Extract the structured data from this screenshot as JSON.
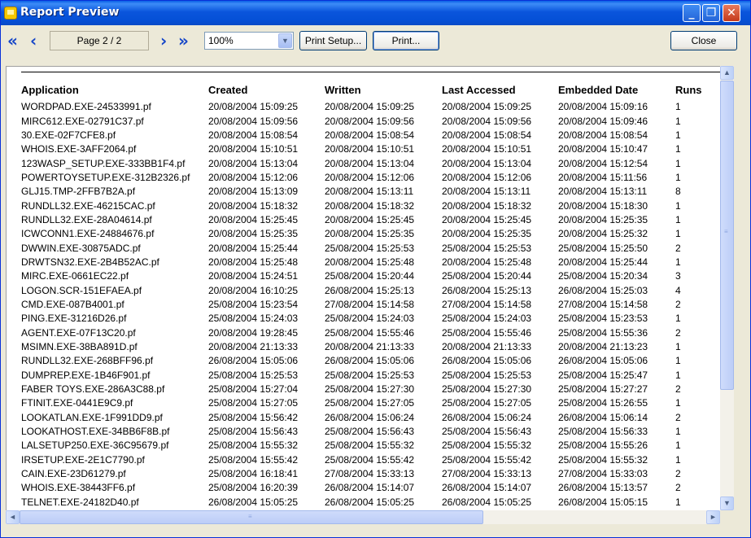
{
  "window": {
    "title": "Report Preview",
    "minimize_glyph": "_",
    "maximize_glyph": "❐",
    "close_glyph": "✕"
  },
  "toolbar": {
    "first_glyph": "«",
    "prev_glyph": "‹",
    "next_glyph": "›",
    "last_glyph": "»",
    "page_label": "Page 2 / 2",
    "zoom_value": "100%",
    "print_setup_label": "Print Setup...",
    "print_label": "Print...",
    "close_label": "Close"
  },
  "icons": {
    "first": "first-page-icon",
    "prev": "previous-page-icon",
    "next": "next-page-icon",
    "last": "last-page-icon"
  },
  "report": {
    "headers": [
      "Application",
      "Created",
      "Written",
      "Last Accessed",
      "Embedded Date",
      "Runs"
    ],
    "rows": [
      [
        "WORDPAD.EXE-24533991.pf",
        "20/08/2004 15:09:25",
        "20/08/2004 15:09:25",
        "20/08/2004 15:09:25",
        "20/08/2004 15:09:16",
        "1"
      ],
      [
        "MIRC612.EXE-02791C37.pf",
        "20/08/2004 15:09:56",
        "20/08/2004 15:09:56",
        "20/08/2004 15:09:56",
        "20/08/2004 15:09:46",
        "1"
      ],
      [
        "30.EXE-02F7CFE8.pf",
        "20/08/2004 15:08:54",
        "20/08/2004 15:08:54",
        "20/08/2004 15:08:54",
        "20/08/2004 15:08:54",
        "1"
      ],
      [
        "WHOIS.EXE-3AFF2064.pf",
        "20/08/2004 15:10:51",
        "20/08/2004 15:10:51",
        "20/08/2004 15:10:51",
        "20/08/2004 15:10:47",
        "1"
      ],
      [
        "123WASP_SETUP.EXE-333BB1F4.pf",
        "20/08/2004 15:13:04",
        "20/08/2004 15:13:04",
        "20/08/2004 15:13:04",
        "20/08/2004 15:12:54",
        "1"
      ],
      [
        "POWERTOYSETUP.EXE-312B2326.pf",
        "20/08/2004 15:12:06",
        "20/08/2004 15:12:06",
        "20/08/2004 15:12:06",
        "20/08/2004 15:11:56",
        "1"
      ],
      [
        "GLJ15.TMP-2FFB7B2A.pf",
        "20/08/2004 15:13:09",
        "20/08/2004 15:13:11",
        "20/08/2004 15:13:11",
        "20/08/2004 15:13:11",
        "8"
      ],
      [
        "RUNDLL32.EXE-46215CAC.pf",
        "20/08/2004 15:18:32",
        "20/08/2004 15:18:32",
        "20/08/2004 15:18:32",
        "20/08/2004 15:18:30",
        "1"
      ],
      [
        "RUNDLL32.EXE-28A04614.pf",
        "20/08/2004 15:25:45",
        "20/08/2004 15:25:45",
        "20/08/2004 15:25:45",
        "20/08/2004 15:25:35",
        "1"
      ],
      [
        "ICWCONN1.EXE-24884676.pf",
        "20/08/2004 15:25:35",
        "20/08/2004 15:25:35",
        "20/08/2004 15:25:35",
        "20/08/2004 15:25:32",
        "1"
      ],
      [
        "DWWIN.EXE-30875ADC.pf",
        "20/08/2004 15:25:44",
        "25/08/2004 15:25:53",
        "25/08/2004 15:25:53",
        "25/08/2004 15:25:50",
        "2"
      ],
      [
        "DRWTSN32.EXE-2B4B52AC.pf",
        "20/08/2004 15:25:48",
        "20/08/2004 15:25:48",
        "20/08/2004 15:25:48",
        "20/08/2004 15:25:44",
        "1"
      ],
      [
        "MIRC.EXE-0661EC22.pf",
        "20/08/2004 15:24:51",
        "25/08/2004 15:20:44",
        "25/08/2004 15:20:44",
        "25/08/2004 15:20:34",
        "3"
      ],
      [
        "LOGON.SCR-151EFAEA.pf",
        "20/08/2004 16:10:25",
        "26/08/2004 15:25:13",
        "26/08/2004 15:25:13",
        "26/08/2004 15:25:03",
        "4"
      ],
      [
        "CMD.EXE-087B4001.pf",
        "25/08/2004 15:23:54",
        "27/08/2004 15:14:58",
        "27/08/2004 15:14:58",
        "27/08/2004 15:14:58",
        "2"
      ],
      [
        "PING.EXE-31216D26.pf",
        "25/08/2004 15:24:03",
        "25/08/2004 15:24:03",
        "25/08/2004 15:24:03",
        "25/08/2004 15:23:53",
        "1"
      ],
      [
        "AGENT.EXE-07F13C20.pf",
        "20/08/2004 19:28:45",
        "25/08/2004 15:55:46",
        "25/08/2004 15:55:46",
        "25/08/2004 15:55:36",
        "2"
      ],
      [
        "MSIMN.EXE-38BA891D.pf",
        "20/08/2004 21:13:33",
        "20/08/2004 21:13:33",
        "20/08/2004 21:13:33",
        "20/08/2004 21:13:23",
        "1"
      ],
      [
        "RUNDLL32.EXE-268BFF96.pf",
        "26/08/2004 15:05:06",
        "26/08/2004 15:05:06",
        "26/08/2004 15:05:06",
        "26/08/2004 15:05:06",
        "1"
      ],
      [
        "DUMPREP.EXE-1B46F901.pf",
        "25/08/2004 15:25:53",
        "25/08/2004 15:25:53",
        "25/08/2004 15:25:53",
        "25/08/2004 15:25:47",
        "1"
      ],
      [
        "FABER TOYS.EXE-286A3C88.pf",
        "25/08/2004 15:27:04",
        "25/08/2004 15:27:30",
        "25/08/2004 15:27:30",
        "25/08/2004 15:27:27",
        "2"
      ],
      [
        "FTINIT.EXE-0441E9C9.pf",
        "25/08/2004 15:27:05",
        "25/08/2004 15:27:05",
        "25/08/2004 15:27:05",
        "25/08/2004 15:26:55",
        "1"
      ],
      [
        "LOOKATLAN.EXE-1F991DD9.pf",
        "25/08/2004 15:56:42",
        "26/08/2004 15:06:24",
        "26/08/2004 15:06:24",
        "26/08/2004 15:06:14",
        "2"
      ],
      [
        "LOOKATHOST.EXE-34BB6F8B.pf",
        "25/08/2004 15:56:43",
        "25/08/2004 15:56:43",
        "25/08/2004 15:56:43",
        "25/08/2004 15:56:33",
        "1"
      ],
      [
        "LALSETUP250.EXE-36C95679.pf",
        "25/08/2004 15:55:32",
        "25/08/2004 15:55:32",
        "25/08/2004 15:55:32",
        "25/08/2004 15:55:26",
        "1"
      ],
      [
        "IRSETUP.EXE-2E1C7790.pf",
        "25/08/2004 15:55:42",
        "25/08/2004 15:55:42",
        "25/08/2004 15:55:42",
        "25/08/2004 15:55:32",
        "1"
      ],
      [
        "CAIN.EXE-23D61279.pf",
        "25/08/2004 16:18:41",
        "27/08/2004 15:33:13",
        "27/08/2004 15:33:13",
        "27/08/2004 15:33:03",
        "2"
      ],
      [
        "WHOIS.EXE-38443FF6.pf",
        "25/08/2004 16:20:39",
        "26/08/2004 15:14:07",
        "26/08/2004 15:14:07",
        "26/08/2004 15:13:57",
        "2"
      ],
      [
        "TELNET.EXE-24182D40.pf",
        "26/08/2004 15:05:25",
        "26/08/2004 15:05:25",
        "26/08/2004 15:05:25",
        "26/08/2004 15:05:15",
        "1"
      ]
    ]
  },
  "scrollbars": {
    "up": "▲",
    "down": "▼",
    "left": "◄",
    "right": "►",
    "grip": "≡"
  },
  "colors": {
    "titlebar": "#0a55dc",
    "nav_arrows": "#1646c8",
    "window_bg": "#ece9d8"
  }
}
